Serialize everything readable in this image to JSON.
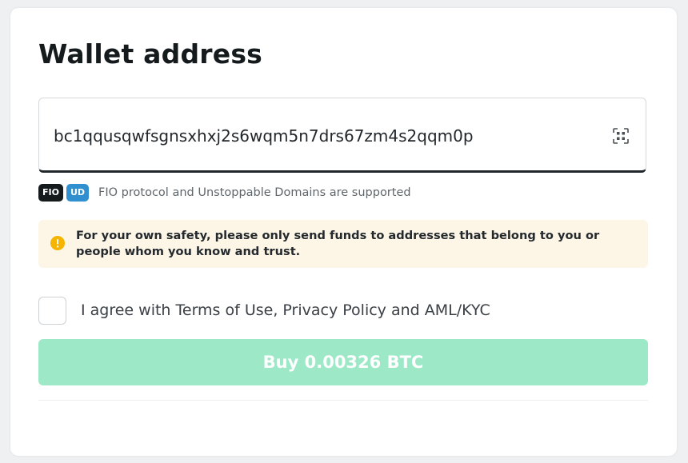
{
  "header": {
    "title": "Wallet address"
  },
  "address": {
    "value": "bc1qqusqwfsgnsxhxj2s6wqm5n7drs67zm4s2qqm0p",
    "scan_icon": "qr-scan-icon"
  },
  "support": {
    "badges": [
      "FIO",
      "UD"
    ],
    "text": "FIO protocol and Unstoppable Domains are supported"
  },
  "warning": {
    "icon": "warning-icon",
    "text": "For your own safety, please only send funds to addresses that belong to you or people whom you know and trust."
  },
  "agreement": {
    "label": "I agree with Terms of Use, Privacy Policy and AML/KYC",
    "checked": false
  },
  "buy_button": {
    "label": "Buy 0.00326 BTC",
    "enabled": false
  },
  "colors": {
    "button_disabled": "#9de8c7",
    "warning_bg": "#fdf6e7",
    "warning_icon": "#f5b400",
    "fio_badge": "#151a1d",
    "ud_badge": "#2f8fcf"
  }
}
